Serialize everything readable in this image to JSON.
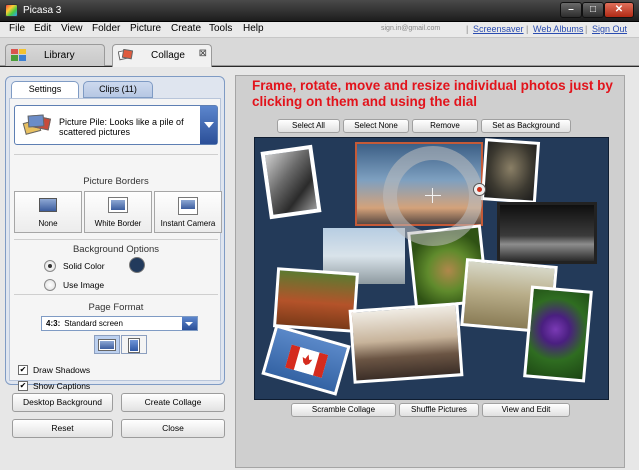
{
  "window": {
    "title": "Picasa 3",
    "controls": {
      "minimize": "–",
      "maximize": "□",
      "close": "✕"
    }
  },
  "menu": [
    "File",
    "Edit",
    "View",
    "Folder",
    "Picture",
    "Create",
    "Tools",
    "Help"
  ],
  "top_links": {
    "user_email": "sign.in@gmail.com",
    "screensaver": "Screensaver",
    "web_albums": "Web Albums",
    "sign_out": "Sign Out",
    "separator": "|"
  },
  "tabs": {
    "library": "Library",
    "collage": "Collage",
    "close_symbol": "⊠"
  },
  "left": {
    "subtabs": {
      "settings": "Settings",
      "clips": "Clips (11)"
    },
    "collage_type": "Picture Pile:  Looks like a pile of scattered pictures",
    "borders": {
      "title": "Picture Borders",
      "none": "None",
      "white": "White Border",
      "instant": "Instant Camera"
    },
    "background": {
      "title": "Background Options",
      "solid": "Solid Color",
      "image": "Use Image",
      "selected": "Solid Color",
      "color": "#223a5c"
    },
    "format": {
      "title": "Page Format",
      "ratio": "4:3:",
      "name": "Standard screen"
    },
    "checks": {
      "shadows": "Draw Shadows",
      "shadows_checked": true,
      "captions": "Show Captions",
      "captions_checked": true,
      "mark": "✔"
    },
    "buttons": {
      "desktop": "Desktop Background",
      "create": "Create Collage",
      "reset": "Reset",
      "close": "Close"
    }
  },
  "work": {
    "caption": "Frame, rotate, move and resize individual photos just by clicking on them and using the dial",
    "top_buttons": {
      "select_all": "Select All",
      "select_none": "Select None",
      "remove": "Remove",
      "set_bg": "Set as Background"
    },
    "bottom_buttons": {
      "scramble": "Scramble Collage",
      "shuffle": "Shuffle Pictures",
      "view_edit": "View and Edit"
    },
    "dial_arrows": {
      "left": "◂",
      "right": "◂"
    }
  }
}
